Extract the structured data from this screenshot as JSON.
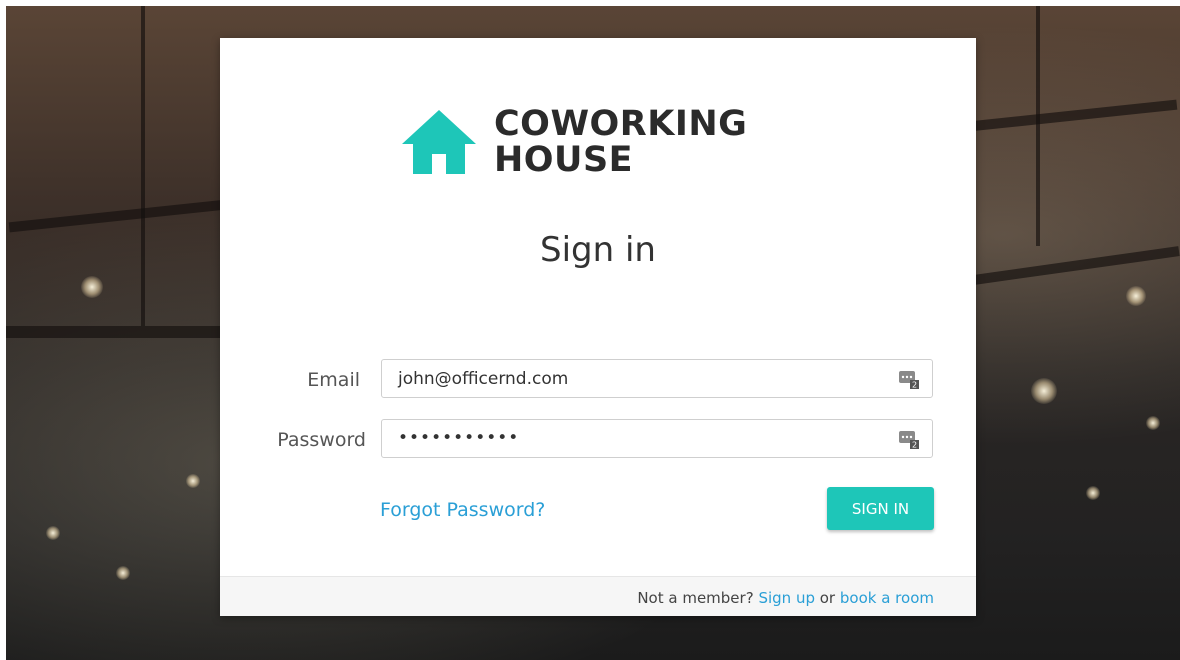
{
  "brand": {
    "line1": "COWORKING",
    "line2": "HOUSE",
    "icon": "house-icon",
    "accent": "#1ec6b8"
  },
  "title": "Sign in",
  "form": {
    "email_label": "Email",
    "email_value": "john@officernd.com",
    "password_label": "Password",
    "password_value": "•••••••••••",
    "forgot_label": "Forgot Password?",
    "submit_label": "SIGN IN"
  },
  "footer": {
    "prefix": "Not a member?",
    "signup_label": "Sign up",
    "or_text": "or",
    "book_label": "book a room"
  },
  "colors": {
    "link": "#2a9fd6",
    "button": "#1ec6b8"
  }
}
